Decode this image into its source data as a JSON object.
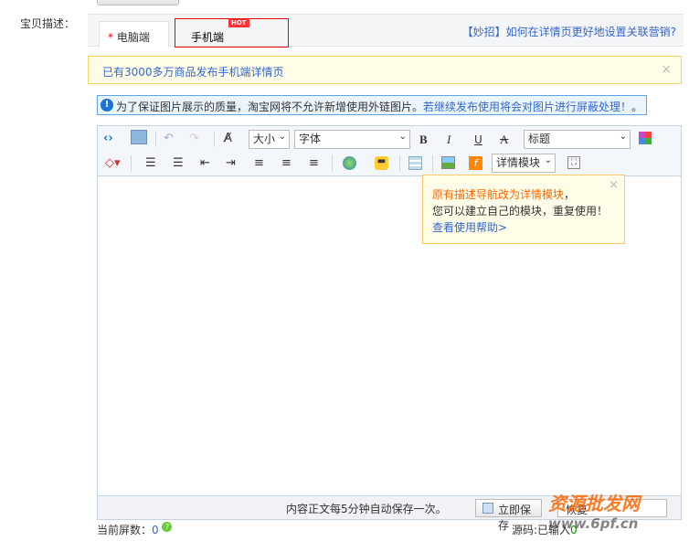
{
  "field_label": "宝贝描述：",
  "tabs": [
    {
      "label": "电脑端",
      "required_mark": "*",
      "active": true
    },
    {
      "label": "手机端",
      "badge": "HOT",
      "active": false
    }
  ],
  "tip_link": "【妙招】如何在详情页更好地设置关联营销?",
  "notice": {
    "text": "已有3000多万商品发布手机端详情页",
    "close": "×"
  },
  "warning": {
    "icon": "info-icon",
    "text": "为了保证图片展示的质量，淘宝网将不允许新增使用外链图片。",
    "link": "若继续发布使用将会对图片进行屏蔽处理！",
    "tail": "。"
  },
  "toolbar": {
    "size_label": "大小",
    "font_label": "字体",
    "heading_label": "标题",
    "module_label": "详情模块",
    "bold": "B",
    "italic": "I",
    "underline": "U",
    "strike": "A"
  },
  "popup": {
    "line1": "原有描述导航改为详情模块",
    "line1_tail": "，",
    "line2": "您可以建立自己的模块，重复使用！",
    "link": "查看使用帮助>",
    "close": "×"
  },
  "status": {
    "autosave": "内容正文每5分钟自动保存一次。",
    "save_button": "立即保存",
    "restore_button": "恢复"
  },
  "footer": {
    "screens_label": "当前屏数：",
    "screens_value": "0",
    "source_label": "源码:已输入",
    "source_value": "0"
  },
  "watermark": {
    "text": "资源批发网",
    "url": "www.6pf.cn"
  },
  "colors": {
    "accent": "#3366cc",
    "orange": "#ff6600",
    "tab_border": "#ee0000"
  }
}
